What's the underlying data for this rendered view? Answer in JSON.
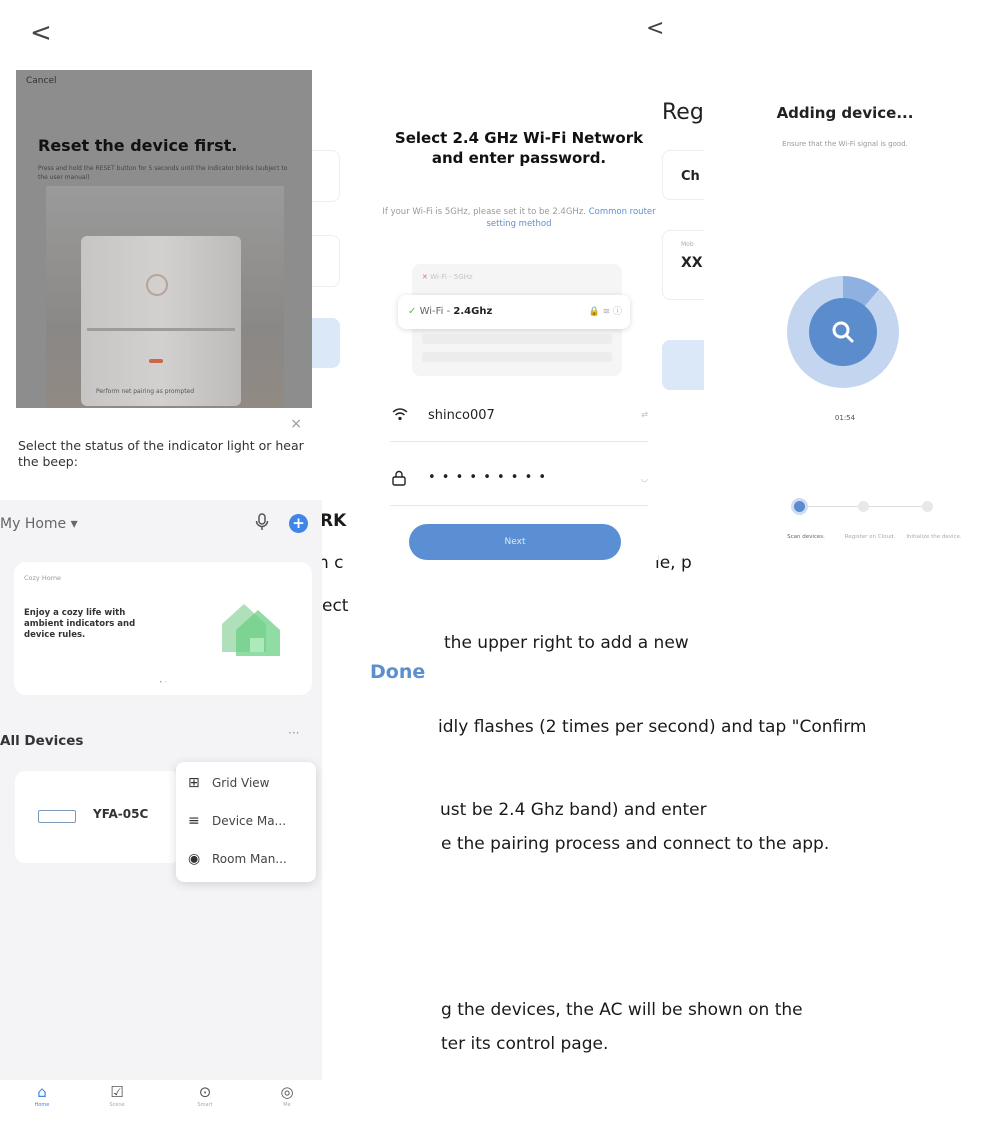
{
  "manual": {
    "heading_fragment": "RK",
    "line1_left": "n c",
    "line1_right": "le, p",
    "line2": "ect",
    "line3": "the upper right to add a new",
    "done": "Done",
    "line4": "idly flashes (2 times per second) and tap \"Confirm",
    "line5": "ust be 2.4 Ghz band) and enter",
    "line6": "e the pairing process and connect to the app.",
    "line7": "g the devices, the AC will be shown on the",
    "line8": "ter its control page."
  },
  "back_icons": [
    "<",
    "<"
  ],
  "reset_dialog": {
    "cancel": "Cancel",
    "title": "Reset the device first.",
    "subtitle": "Press and hold the RESET button for 5 seconds until the indicator blinks (subject to the user manual)",
    "mode_text": "Perform net pairing as prompted",
    "close": "×",
    "question": "Select the status of the indicator light or hear the beep:"
  },
  "wifi_setup": {
    "title": "Select 2.4 GHz Wi-Fi Network and enter password.",
    "hint": "If your Wi-Fi is 5GHz, please set it to be 2.4GHz.",
    "hint_link": "Common router setting method",
    "bad_network": "Wi-Fi - 5GHz",
    "good_prefix": "Wi-Fi - ",
    "good_band": "2.4Ghz",
    "ssid": "shinco007",
    "password_mask": "• • • • • • • • •",
    "next": "Next"
  },
  "register_partial": {
    "title": "Reg",
    "field1": "Ch",
    "field2_label": "Mob",
    "field2_value": "XX"
  },
  "adding": {
    "title": "Adding device...",
    "subtitle": "Ensure that the Wi-Fi signal is good.",
    "timer": "01:54",
    "steps": [
      "Scan devices.",
      "Register on Cloud.",
      "Initialize the device."
    ]
  },
  "home": {
    "home_label": "My Home ▾",
    "card_tag": "Cozy Home",
    "card_body": "Enjoy a cozy life with ambient indicators and device rules.",
    "pager": "• ◦",
    "all_devices": "All Devices",
    "more": "···",
    "device_name": "YFA-05C",
    "menu": [
      {
        "icon": "grid-view-icon",
        "label": "Grid View"
      },
      {
        "icon": "device-manage-icon",
        "label": "Device Ma..."
      },
      {
        "icon": "room-manage-icon",
        "label": "Room Man..."
      }
    ],
    "tabs": [
      "Home",
      "Scene",
      "Smart",
      "Me"
    ]
  },
  "colors": {
    "accent": "#3f86e8",
    "button": "#5b8fd3",
    "dim": "#8d8d8d"
  }
}
